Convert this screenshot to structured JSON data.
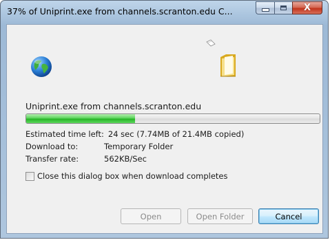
{
  "window": {
    "title": "37% of Uniprint.exe from channels.scranton.edu C...",
    "progress_percent": 37
  },
  "caption": {
    "minimize_icon": "minimize-icon",
    "maximize_icon": "maximize-icon",
    "close_glyph": "X"
  },
  "download": {
    "filename_line": "Uniprint.exe from channels.scranton.edu",
    "progress_fraction": 0.37,
    "estimated_label": "Estimated time left:",
    "estimated_value": "24 sec (7.74MB of 21.4MB copied)",
    "download_to_label": "Download to:",
    "download_to_value": "Temporary Folder",
    "rate_label": "Transfer rate:",
    "rate_value": "562KB/Sec"
  },
  "options": {
    "close_when_done_label": "Close this dialog box when download completes",
    "close_when_done_checked": false
  },
  "buttons": {
    "open": "Open",
    "open_folder": "Open Folder",
    "cancel": "Cancel"
  },
  "colors": {
    "progress_green": "#27b527",
    "close_red": "#c1341c",
    "title_blue": "#aac4de"
  }
}
